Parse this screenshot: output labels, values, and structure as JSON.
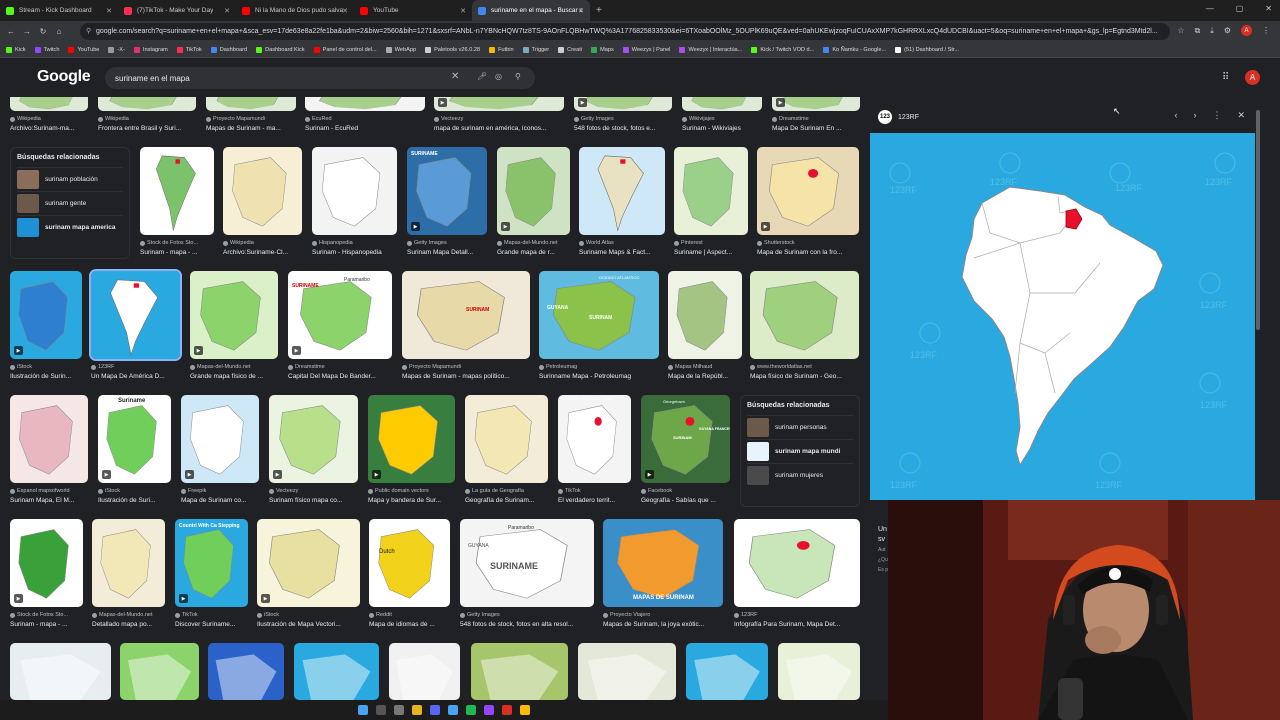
{
  "tabs": [
    {
      "title": "Stream - Kick Dashboard",
      "color": "#53fc18"
    },
    {
      "title": "(7)TikTok - Make Your Day",
      "color": "#fe2c55"
    },
    {
      "title": "Ni la Mano de Dios pudo salva",
      "color": "#ff0000"
    },
    {
      "title": "YouTube",
      "color": "#ff0000"
    },
    {
      "title": "suriname en el mapa - Buscar c",
      "color": "#4285f4",
      "active": true
    }
  ],
  "window_controls": [
    "—",
    "▢",
    "✕"
  ],
  "url": "google.com/search?q=suriname+en+el+mapa+&sca_esv=17de63e8a22fe1ba&udm=2&biw=2560&bih=1271&sxsrf=ANbL-n7YBNcHQW7tz8TS-9AOnFLQBHwTWQ%3A1776825833530&ei=6TXoabOOlMz_5OUPlK69uQE&ved=0ahUKEwjzoqFuICUAxXMP7kGHRRXLxcQ4dUDCBI&uact=5&oq=suriname+en+el+mapa+&gs_lp=Egtnd3Mtd2l...",
  "bookmarks": [
    {
      "label": "Kick",
      "color": "#53fc18"
    },
    {
      "label": "Twitch",
      "color": "#9146ff"
    },
    {
      "label": "YouTube",
      "color": "#ff0000"
    },
    {
      "label": "-X-",
      "color": "#999"
    },
    {
      "label": "Instagram",
      "color": "#e1306c"
    },
    {
      "label": "TikTok",
      "color": "#fe2c55"
    },
    {
      "label": "Dashboard",
      "color": "#4285f4"
    },
    {
      "label": "Dashboard Kick",
      "color": "#53fc18"
    },
    {
      "label": "Panel de control del...",
      "color": "#ff0000"
    },
    {
      "label": "WebApp",
      "color": "#aaa"
    },
    {
      "label": "Paletools v26.0.28",
      "color": "#ccc"
    },
    {
      "label": "Futbin",
      "color": "#f5b800"
    },
    {
      "label": "Trigger",
      "color": "#7ab"
    },
    {
      "label": "Creati",
      "color": "#ccc"
    },
    {
      "label": "Maps",
      "color": "#34a853"
    },
    {
      "label": "Weezyx | Panel",
      "color": "#a64ff0"
    },
    {
      "label": "Weezyx | Interactúa...",
      "color": "#a64ff0"
    },
    {
      "label": "Kick / Twitch VOD d...",
      "color": "#53fc18"
    },
    {
      "label": "Ko Ñamku - Google...",
      "color": "#4285f4"
    },
    {
      "label": "(51) Dashboard / Str...",
      "color": "#fff"
    }
  ],
  "google": {
    "logo": "Google",
    "query": "suriname en el mapa",
    "avatar": "A"
  },
  "top_row": [
    {
      "src": "Wikipedia",
      "title": "Archivo:Surinam-ma..."
    },
    {
      "src": "Wikipedia",
      "title": "Frontera entre Brasil y Suri..."
    },
    {
      "src": "Proyecto Mapamundi",
      "title": "Mapas de Surinam - ma..."
    },
    {
      "src": "EcuRed",
      "title": "Surinam - EcuRed"
    },
    {
      "src": "Vecteezy",
      "title": "mapa de surinam en américa, íconos..."
    },
    {
      "src": "Getty Images",
      "title": "548 fotos de stock, fotos e..."
    },
    {
      "src": "Wikivijajes",
      "title": "Surinam - Wikiviajes"
    },
    {
      "src": "Dreamstime",
      "title": "Mapa De Surinam En ..."
    }
  ],
  "related1": {
    "heading": "Búsquedas relacionadas",
    "items": [
      "surinam población",
      "surinam gente",
      "surinam mapa america"
    ]
  },
  "row1": [
    {
      "src": "Stock de Fotos Sto...",
      "title": "Surinam - mapa - ..."
    },
    {
      "src": "Wikipedia",
      "title": "Archivo:Suriname-Cl..."
    },
    {
      "src": "Hispanopedia",
      "title": "Surinam - Hispanopedia"
    },
    {
      "src": "Getty Images",
      "title": "Surinam Mapa Detall..."
    },
    {
      "src": "Mapas-del-Mundo.net",
      "title": "Grande mapa de r..."
    },
    {
      "src": "World Atlas",
      "title": "Suriname Maps & Fact..."
    },
    {
      "src": "Pinterest",
      "title": "Suriname | Aspect..."
    },
    {
      "src": "Shutterstock",
      "title": "Mapa de Surinam con la fro..."
    }
  ],
  "row2": [
    {
      "src": "iStock",
      "title": "Ilustración de Surin..."
    },
    {
      "src": "123RF",
      "title": "Un Mapa De América D..."
    },
    {
      "src": "Mapas-del-Mundo.net",
      "title": "Grande mapa físico de ..."
    },
    {
      "src": "Dreamstime",
      "title": "Capital Del Mapa De Bander..."
    },
    {
      "src": "Proyecto Mapamundi",
      "title": "Mapas de Surinam - mapas político..."
    },
    {
      "src": "Petroleumag",
      "title": "Surinname Mapa - Petroleumag"
    },
    {
      "src": "Mapas Milhaud",
      "title": "Mapa de la Repúbl..."
    },
    {
      "src": "www.theworldatlas.net",
      "title": "Mapa físico de Surinam - Geo..."
    }
  ],
  "row3": [
    {
      "src": "Espanol mapsofworld",
      "title": "Surinam Mapa, El M..."
    },
    {
      "src": "iStock",
      "title": "Ilustración de Suri..."
    },
    {
      "src": "Freepik",
      "title": "Mapa de Surinam co..."
    },
    {
      "src": "Vecteezy",
      "title": "Surinam físico mapa co..."
    },
    {
      "src": "Public domain vectors",
      "title": "Mapa y bandera de Sur..."
    },
    {
      "src": "La guía de Geografía",
      "title": "Geografía de Surinam..."
    },
    {
      "src": "TikTok",
      "title": "El verdadero territ..."
    },
    {
      "src": "Facebook",
      "title": "Geografía - Sabías que ..."
    }
  ],
  "row3_labels": {
    "suriname_word": "Suriname",
    "georgetown": "Georgetown",
    "guyana": "GUYANA",
    "guyana_fr": "GUYANA FRANCESA",
    "surinam": "SURINAM",
    "verdadero": "el verdadero territorio de surinam"
  },
  "related2": {
    "heading": "Búsquedas relacionadas",
    "items": [
      "surinam personas",
      "surinam mapa mundi",
      "surinam mujeres"
    ]
  },
  "row4": [
    {
      "src": "Stock de Fotos Sto...",
      "title": "Surinam - mapa - ..."
    },
    {
      "src": "Mapas-del-Mundo.net",
      "title": "Detallado mapa po..."
    },
    {
      "src": "TikTok",
      "title": "Discover Suriname..."
    },
    {
      "src": "iStock",
      "title": "Ilustración de Mapa Vectori..."
    },
    {
      "src": "Reddit",
      "title": "Mapa de idiomas de ..."
    },
    {
      "src": "Getty Images",
      "title": "548 fotos de stock, fotos en alta resol..."
    },
    {
      "src": "Proyecto Viajero",
      "title": "Mapas de Surinam, la joya exótic..."
    },
    {
      "src": "123RF",
      "title": "Infografía Para Surinam, Mapa Det..."
    }
  ],
  "row4_labels": {
    "countries": "Countri With Ca Stepping",
    "dutch": "Dutch",
    "suriname": "SURINAME",
    "paramaribo": "Paramaribo",
    "guyana": "GUYANA",
    "mapas": "MAPAS DE SURINAM"
  },
  "row2_labels": {
    "suriname": "SURINAME",
    "paramaribo": "Paramaribo",
    "surinam": "SURINAM",
    "guyana": "GUYANA",
    "oceano": "OCEANO ATLANTICO"
  },
  "row1_labels": {
    "suriname": "SURINAME"
  },
  "preview": {
    "source": "123RF",
    "logo": "123",
    "watermark": "123RF",
    "side_text": [
      "Un",
      "sv",
      "Aut",
      "¿Qu",
      "Es p"
    ]
  },
  "colors": {
    "accent": "#8ab4f8",
    "sea": "#29a9df",
    "highlight": "#e8112d"
  }
}
